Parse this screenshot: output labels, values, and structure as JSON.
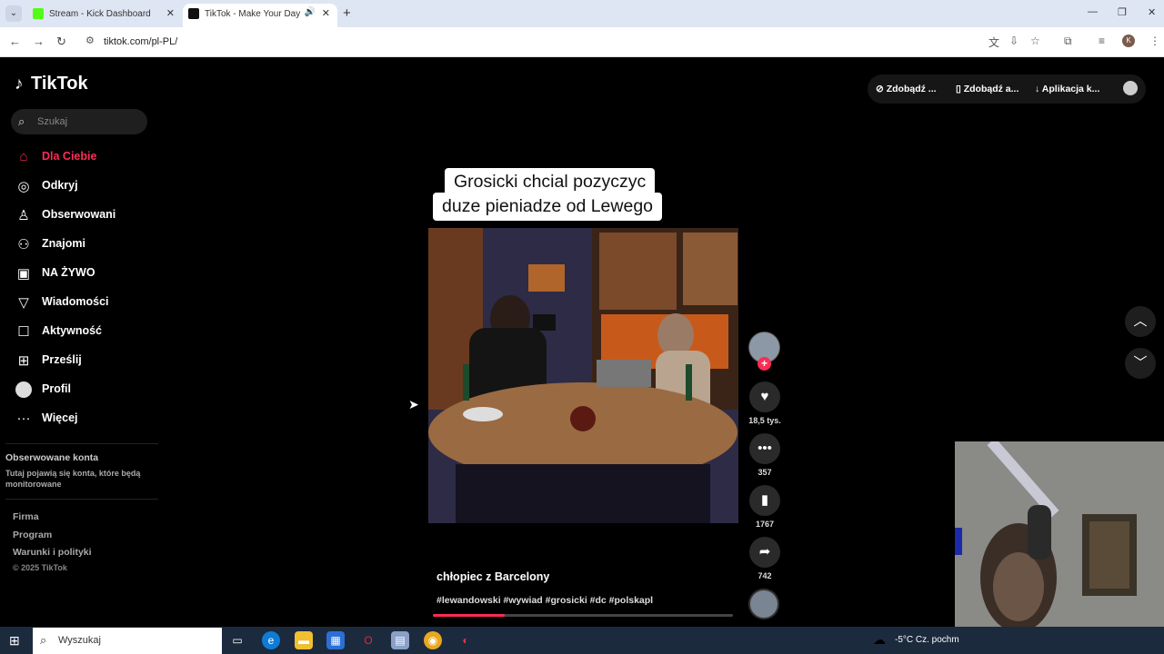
{
  "browser": {
    "tabs": [
      {
        "label": "Stream - Kick Dashboard",
        "icon_color": "#53fc18"
      },
      {
        "label": "TikTok - Make Your Day",
        "active": true
      }
    ],
    "url": "tiktok.com/pl-PL/"
  },
  "tiktok": {
    "logo": "TikTok",
    "search_placeholder": "Szukaj",
    "menu": [
      {
        "label": "Dla Ciebie",
        "icon": "home-icon",
        "active": true
      },
      {
        "label": "Odkryj",
        "icon": "compass-icon"
      },
      {
        "label": "Obserwowani",
        "icon": "following-icon"
      },
      {
        "label": "Znajomi",
        "icon": "friends-icon"
      },
      {
        "label": "NA ŻYWO",
        "icon": "live-icon"
      },
      {
        "label": "Wiadomości",
        "icon": "messages-icon"
      },
      {
        "label": "Aktywność",
        "icon": "activity-icon"
      },
      {
        "label": "Prześlij",
        "icon": "upload-icon"
      },
      {
        "label": "Profil",
        "icon": "avatar"
      },
      {
        "label": "Więcej",
        "icon": "more-icon"
      }
    ],
    "followed_title": "Obserwowane konta",
    "followed_desc": "Tutaj pojawią się konta, które będą monitorowane",
    "footer_links": [
      "Firma",
      "Program",
      "Warunki i polityki"
    ],
    "copyright": "© 2025 TikTok",
    "top_buttons": [
      "Zdobądź ...",
      "Zdobądź a...",
      "Aplikacja k..."
    ],
    "accent": "#fe2c55"
  },
  "video": {
    "caption_line1": "Grosicki chcial pozyczyc",
    "caption_line2": "duze pieniadze od Lewego",
    "description": "chłopiec z Barcelony",
    "hashtags": "#lewandowski #wywiad #grosicki #dc #polskapl",
    "progress": 0.24,
    "likes": "18,5 tys.",
    "comments": "357",
    "saves": "1767",
    "shares": "742"
  },
  "taskbar": {
    "search_placeholder": "Wyszukaj",
    "weather": "-5°C  Cz. pochm"
  }
}
